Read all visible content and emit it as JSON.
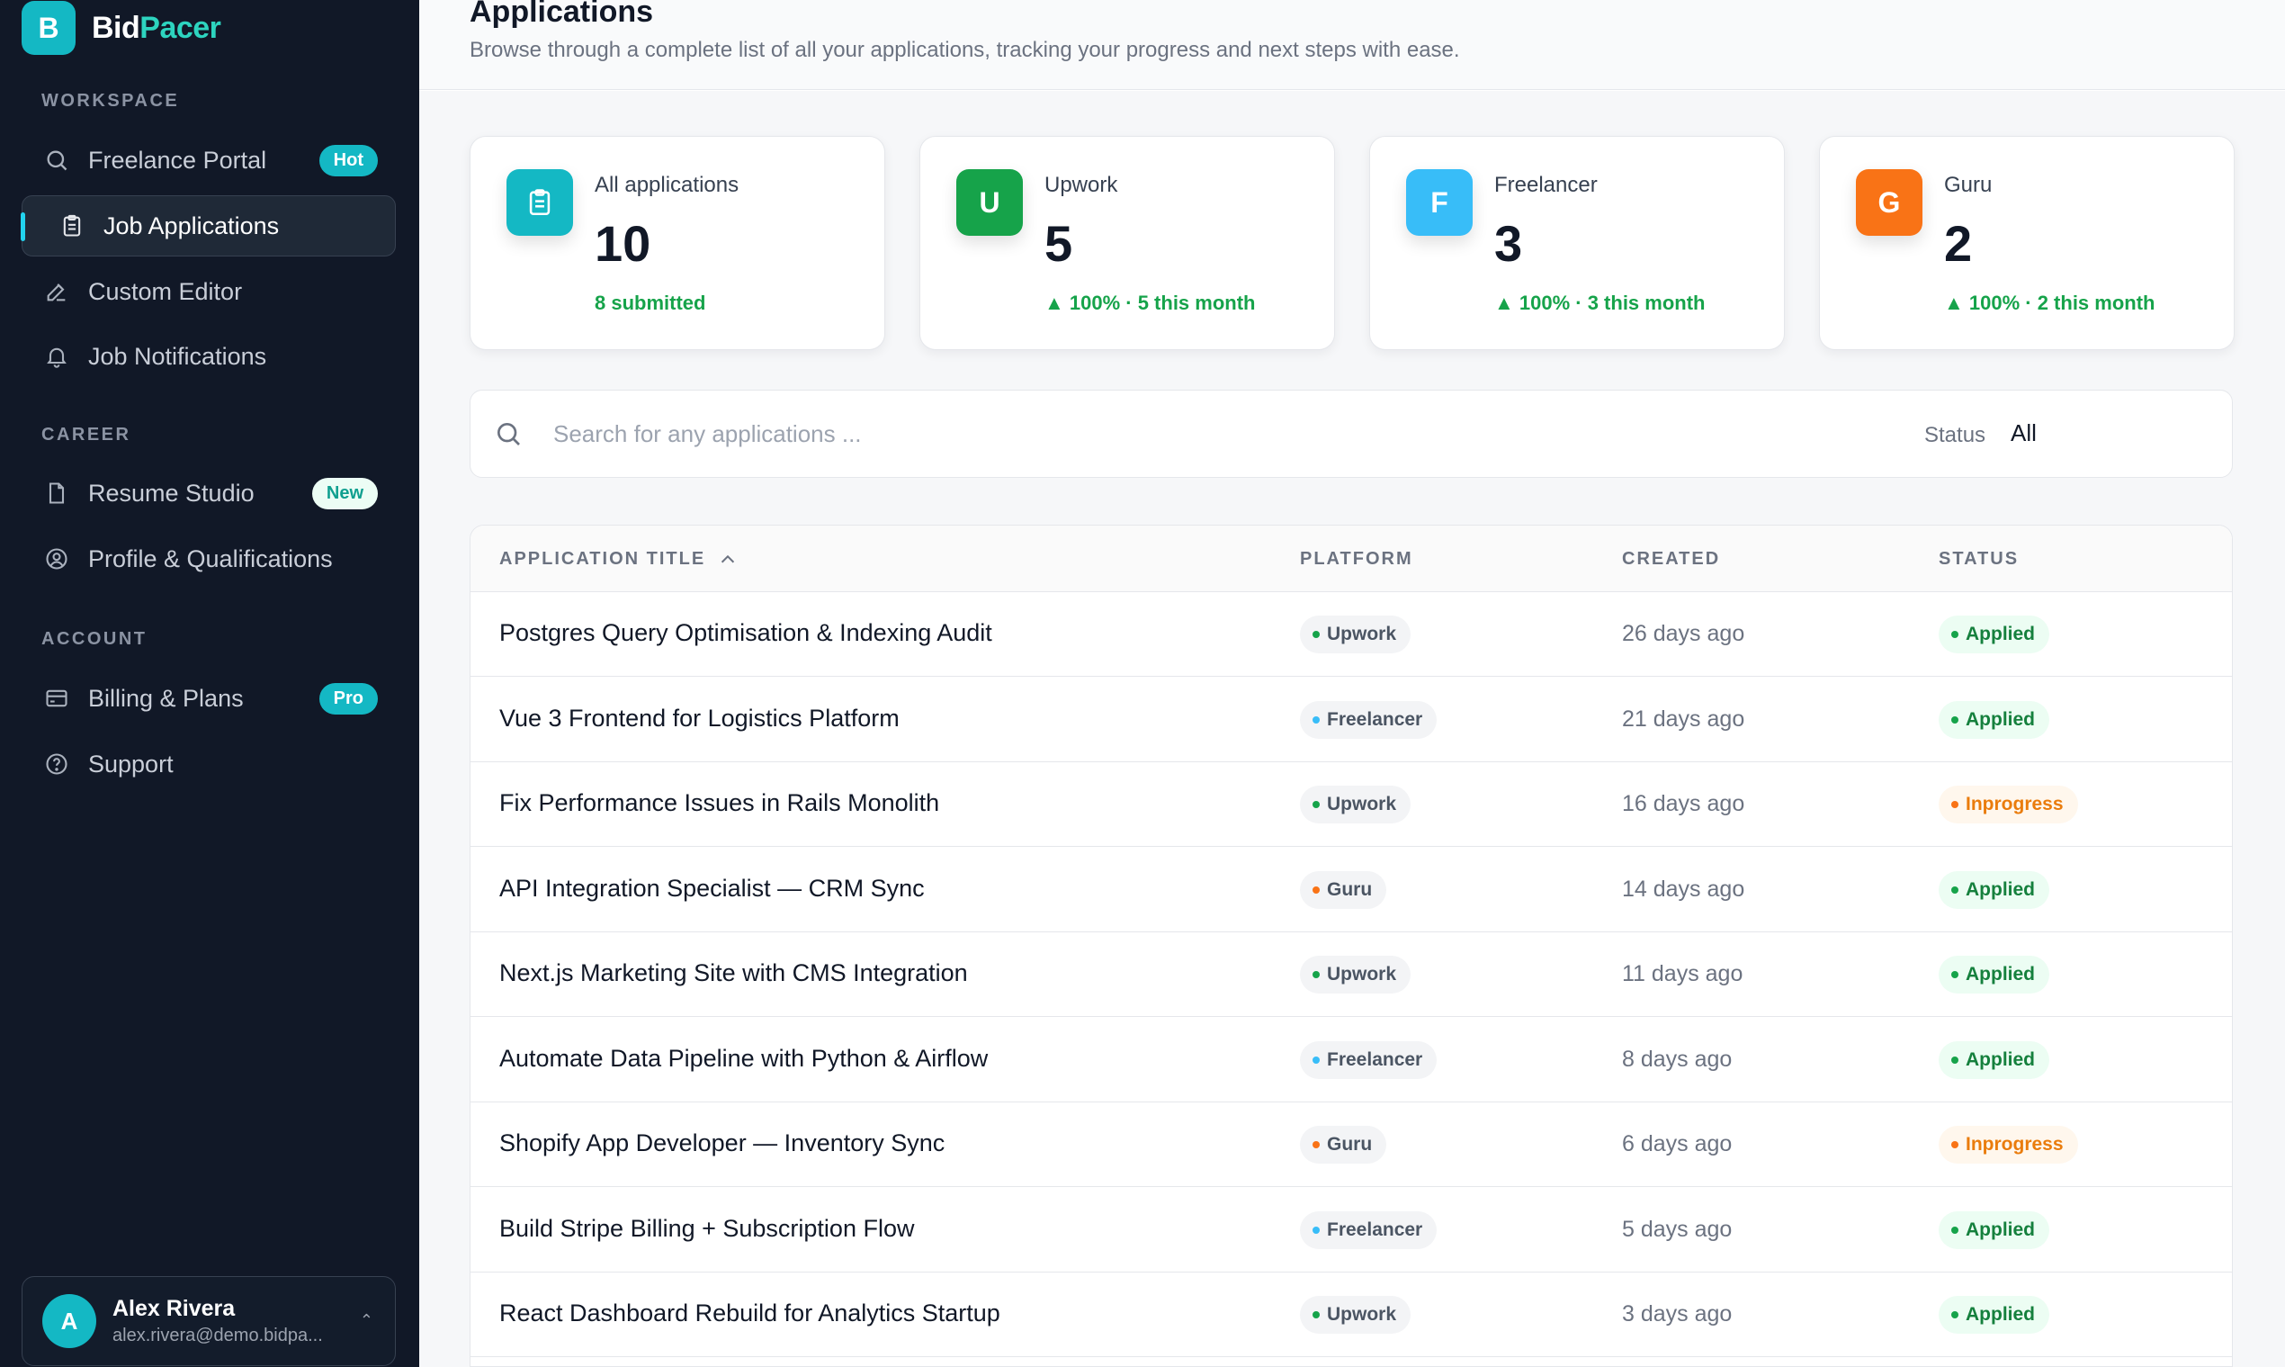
{
  "brand": {
    "logo_letter": "B",
    "name_part1": "Bid",
    "name_part2": "Pacer"
  },
  "sidebar": {
    "sections": [
      {
        "label": "WORKSPACE"
      },
      {
        "label": "CAREER"
      },
      {
        "label": "ACCOUNT"
      }
    ],
    "items": [
      {
        "label": "Freelance Portal",
        "icon": "search-icon",
        "badge": "Hot"
      },
      {
        "label": "Job Applications",
        "icon": "clipboard-icon",
        "active": true
      },
      {
        "label": "Custom Editor",
        "icon": "edit-icon"
      },
      {
        "label": "Job Notifications",
        "icon": "bell-icon"
      },
      {
        "label": "Resume Studio",
        "icon": "document-icon",
        "badge": "New"
      },
      {
        "label": "Profile & Qualifications",
        "icon": "user-circle-icon"
      },
      {
        "label": "Billing & Plans",
        "icon": "credit-card-icon",
        "badge": "Pro"
      },
      {
        "label": "Support",
        "icon": "help-icon"
      }
    ],
    "user": {
      "initial": "A",
      "name": "Alex Rivera",
      "email": "alex.rivera@demo.bidpa...",
      "chevron": "⌃"
    }
  },
  "header": {
    "title": "Applications",
    "subtitle": "Browse through a complete list of all your applications, tracking your progress and next steps with ease."
  },
  "stats": [
    {
      "label": "All applications",
      "value": "10",
      "sub": "8 submitted",
      "icon_letter": "",
      "color": "#14b8c4"
    },
    {
      "label": "Upwork",
      "value": "5",
      "sub": "▲ 100% · 5 this month",
      "icon_letter": "U",
      "color": "#16a34a"
    },
    {
      "label": "Freelancer",
      "value": "3",
      "sub": "▲ 100% · 3 this month",
      "icon_letter": "F",
      "color": "#38bdf8"
    },
    {
      "label": "Guru",
      "value": "2",
      "sub": "▲ 100% · 2 this month",
      "icon_letter": "G",
      "color": "#f97316"
    }
  ],
  "search": {
    "placeholder": "Search for any applications ...",
    "status_label": "Status",
    "status_value": "All"
  },
  "table": {
    "headers": {
      "title": "APPLICATION TITLE",
      "platform": "PLATFORM",
      "created": "CREATED",
      "status": "STATUS"
    },
    "rows": [
      {
        "title": "Postgres Query Optimisation & Indexing Audit",
        "platform": "Upwork",
        "created": "26 days ago",
        "status": "Applied"
      },
      {
        "title": "Vue 3 Frontend for Logistics Platform",
        "platform": "Freelancer",
        "created": "21 days ago",
        "status": "Applied"
      },
      {
        "title": "Fix Performance Issues in Rails Monolith",
        "platform": "Upwork",
        "created": "16 days ago",
        "status": "Inprogress"
      },
      {
        "title": "API Integration Specialist — CRM Sync",
        "platform": "Guru",
        "created": "14 days ago",
        "status": "Applied"
      },
      {
        "title": "Next.js Marketing Site with CMS Integration",
        "platform": "Upwork",
        "created": "11 days ago",
        "status": "Applied"
      },
      {
        "title": "Automate Data Pipeline with Python & Airflow",
        "platform": "Freelancer",
        "created": "8 days ago",
        "status": "Applied"
      },
      {
        "title": "Shopify App Developer — Inventory Sync",
        "platform": "Guru",
        "created": "6 days ago",
        "status": "Inprogress"
      },
      {
        "title": "Build Stripe Billing + Subscription Flow",
        "platform": "Freelancer",
        "created": "5 days ago",
        "status": "Applied"
      },
      {
        "title": "React Dashboard Rebuild for Analytics Startup",
        "platform": "Upwork",
        "created": "3 days ago",
        "status": "Applied"
      }
    ]
  },
  "colors": {
    "upwork": "#16a34a",
    "freelancer": "#38bdf8",
    "guru": "#f97316",
    "applied_bg": "#ecfdf3",
    "applied_fg": "#15803d",
    "inprogress_bg": "#fff7ed",
    "inprogress_fg": "#ea7c0c",
    "accent": "#14b8c4"
  }
}
